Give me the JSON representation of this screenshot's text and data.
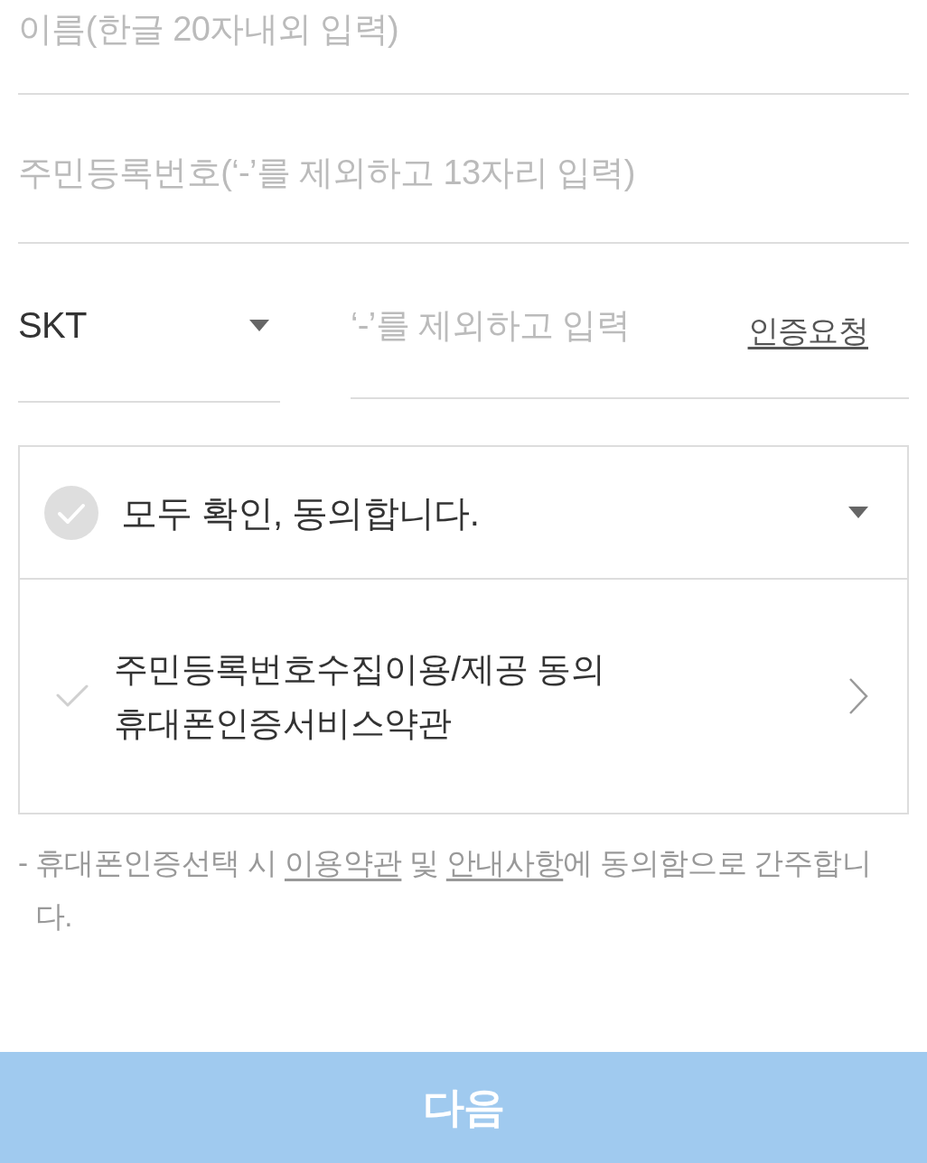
{
  "name_field": {
    "placeholder": "이름(한글 20자내외 입력)"
  },
  "rrn_field": {
    "placeholder": "주민등록번호(‘-’를 제외하고 13자리 입력)"
  },
  "phone": {
    "carrier": "SKT",
    "placeholder": "‘-’를 제외하고 입력",
    "request_link": "인증요청"
  },
  "agreement": {
    "all": {
      "label": "모두 확인, 동의합니다.",
      "checked": false
    },
    "items": [
      {
        "lines": [
          "주민등록번호수집이용/제공 동의",
          "휴대폰인증서비스약관"
        ],
        "checked": false
      }
    ]
  },
  "notice": {
    "marker": "-",
    "parts": [
      {
        "kind": "text",
        "text": "휴대폰인증선택 시 "
      },
      {
        "kind": "link",
        "text": "이용약관"
      },
      {
        "kind": "text",
        "text": " 및 "
      },
      {
        "kind": "link",
        "text": "안내사항"
      },
      {
        "kind": "text",
        "text": "에 동의함으로 간주합니다."
      }
    ]
  },
  "next_button": {
    "label": "다음"
  }
}
